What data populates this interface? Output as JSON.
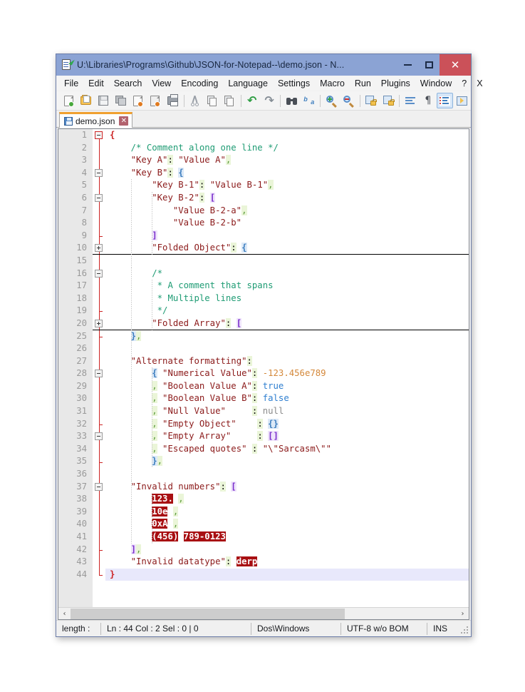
{
  "window": {
    "title": "U:\\Libraries\\Programs\\Github\\JSON-for-Notepad--\\demo.json - N...",
    "icon": "notepad-plus-plus-icon",
    "minimize_label": "",
    "maximize_label": "",
    "close_label": "✕"
  },
  "menubar": {
    "items": [
      {
        "label": "File"
      },
      {
        "label": "Edit"
      },
      {
        "label": "Search"
      },
      {
        "label": "View"
      },
      {
        "label": "Encoding"
      },
      {
        "label": "Language"
      },
      {
        "label": "Settings"
      },
      {
        "label": "Macro"
      },
      {
        "label": "Run"
      },
      {
        "label": "Plugins"
      },
      {
        "label": "Window"
      },
      {
        "label": "?"
      },
      {
        "label": "X"
      }
    ]
  },
  "toolbar": {
    "buttons": [
      {
        "name": "new-file-icon"
      },
      {
        "name": "open-file-icon"
      },
      {
        "name": "save-icon"
      },
      {
        "name": "save-all-icon"
      },
      {
        "name": "close-file-icon"
      },
      {
        "name": "close-all-files-icon"
      },
      {
        "name": "print-icon"
      },
      {
        "name": "cut-icon"
      },
      {
        "name": "copy-icon"
      },
      {
        "name": "paste-icon"
      },
      {
        "name": "undo-icon"
      },
      {
        "name": "redo-icon"
      },
      {
        "name": "find-icon"
      },
      {
        "name": "replace-icon"
      },
      {
        "name": "zoom-in-icon"
      },
      {
        "name": "zoom-out-icon"
      },
      {
        "name": "sync-vertical-scroll-icon"
      },
      {
        "name": "sync-horizontal-scroll-icon"
      },
      {
        "name": "word-wrap-icon"
      },
      {
        "name": "show-all-characters-icon"
      },
      {
        "name": "indent-guide-icon"
      },
      {
        "name": "show-ui-macro-icon"
      }
    ]
  },
  "tabs": [
    {
      "label": "demo.json",
      "close_label": "✕",
      "active": true
    }
  ],
  "editor": {
    "lines": [
      {
        "num": "1",
        "fold": "minus-red",
        "tokens": [
          {
            "t": "{",
            "c": "s-brace-red"
          }
        ]
      },
      {
        "num": "2",
        "fold": "line",
        "tokens": [
          {
            "t": "    ",
            "c": "s-plain"
          },
          {
            "t": "/* Comment along one line */",
            "c": "s-cmt"
          }
        ]
      },
      {
        "num": "3",
        "fold": "line",
        "tokens": [
          {
            "t": "    ",
            "c": "s-plain"
          },
          {
            "t": "\"Key A\"",
            "c": "s-str"
          },
          {
            "t": ":",
            "c": "s-colon"
          },
          {
            "t": " ",
            "c": "s-plain"
          },
          {
            "t": "\"Value A\"",
            "c": "s-str"
          },
          {
            "t": ",",
            "c": "s-comma"
          }
        ]
      },
      {
        "num": "4",
        "fold": "minus",
        "tokens": [
          {
            "t": "    ",
            "c": "s-plain"
          },
          {
            "t": "\"Key B\"",
            "c": "s-str"
          },
          {
            "t": ":",
            "c": "s-colon"
          },
          {
            "t": " ",
            "c": "s-plain"
          },
          {
            "t": "{",
            "c": "s-brace2"
          }
        ]
      },
      {
        "num": "5",
        "fold": "line",
        "tokens": [
          {
            "t": "        ",
            "c": "s-plain"
          },
          {
            "t": "\"Key B-1\"",
            "c": "s-str"
          },
          {
            "t": ":",
            "c": "s-colon"
          },
          {
            "t": " ",
            "c": "s-plain"
          },
          {
            "t": "\"Value B-1\"",
            "c": "s-str"
          },
          {
            "t": ",",
            "c": "s-comma"
          }
        ]
      },
      {
        "num": "6",
        "fold": "minus",
        "tokens": [
          {
            "t": "        ",
            "c": "s-plain"
          },
          {
            "t": "\"Key B-2\"",
            "c": "s-str"
          },
          {
            "t": ":",
            "c": "s-colon"
          },
          {
            "t": " ",
            "c": "s-plain"
          },
          {
            "t": "[",
            "c": "s-brace"
          }
        ]
      },
      {
        "num": "7",
        "fold": "line",
        "tokens": [
          {
            "t": "            ",
            "c": "s-plain"
          },
          {
            "t": "\"Value B-2-a\"",
            "c": "s-str"
          },
          {
            "t": ",",
            "c": "s-comma"
          }
        ]
      },
      {
        "num": "8",
        "fold": "line",
        "tokens": [
          {
            "t": "            ",
            "c": "s-plain"
          },
          {
            "t": "\"Value B-2-b\"",
            "c": "s-str"
          }
        ]
      },
      {
        "num": "9",
        "fold": "tick",
        "tokens": [
          {
            "t": "        ",
            "c": "s-plain"
          },
          {
            "t": "]",
            "c": "s-brace"
          }
        ]
      },
      {
        "num": "10",
        "fold": "plus",
        "rule": true,
        "tokens": [
          {
            "t": "        ",
            "c": "s-plain"
          },
          {
            "t": "\"Folded Object\"",
            "c": "s-str"
          },
          {
            "t": ":",
            "c": "s-colon"
          },
          {
            "t": " ",
            "c": "s-plain"
          },
          {
            "t": "{",
            "c": "s-brace2"
          }
        ]
      },
      {
        "num": "15",
        "fold": "line",
        "tokens": []
      },
      {
        "num": "16",
        "fold": "minus",
        "tokens": [
          {
            "t": "        ",
            "c": "s-plain"
          },
          {
            "t": "/*",
            "c": "s-cmt"
          }
        ]
      },
      {
        "num": "17",
        "fold": "line",
        "tokens": [
          {
            "t": "         ",
            "c": "s-plain"
          },
          {
            "t": "* A comment that spans",
            "c": "s-cmt"
          }
        ]
      },
      {
        "num": "18",
        "fold": "line",
        "tokens": [
          {
            "t": "         ",
            "c": "s-plain"
          },
          {
            "t": "* Multiple lines",
            "c": "s-cmt"
          }
        ]
      },
      {
        "num": "19",
        "fold": "tick",
        "tokens": [
          {
            "t": "         ",
            "c": "s-plain"
          },
          {
            "t": "*/",
            "c": "s-cmt"
          }
        ]
      },
      {
        "num": "20",
        "fold": "plus",
        "rule": true,
        "tokens": [
          {
            "t": "        ",
            "c": "s-plain"
          },
          {
            "t": "\"Folded Array\"",
            "c": "s-str"
          },
          {
            "t": ":",
            "c": "s-colon"
          },
          {
            "t": " ",
            "c": "s-plain"
          },
          {
            "t": "[",
            "c": "s-brace"
          }
        ]
      },
      {
        "num": "25",
        "fold": "tick",
        "tokens": [
          {
            "t": "    ",
            "c": "s-plain"
          },
          {
            "t": "}",
            "c": "s-brace2"
          },
          {
            "t": ",",
            "c": "s-comma"
          }
        ]
      },
      {
        "num": "26",
        "fold": "line",
        "tokens": []
      },
      {
        "num": "27",
        "fold": "line",
        "tokens": [
          {
            "t": "    ",
            "c": "s-plain"
          },
          {
            "t": "\"Alternate formatting\"",
            "c": "s-str"
          },
          {
            "t": ":",
            "c": "s-colon"
          }
        ]
      },
      {
        "num": "28",
        "fold": "minus",
        "tokens": [
          {
            "t": "        ",
            "c": "s-plain"
          },
          {
            "t": "{",
            "c": "s-brace2"
          },
          {
            "t": " ",
            "c": "s-plain"
          },
          {
            "t": "\"Numerical Value\"",
            "c": "s-str"
          },
          {
            "t": ":",
            "c": "s-colon"
          },
          {
            "t": " ",
            "c": "s-plain"
          },
          {
            "t": "-123.456e789",
            "c": "s-num"
          }
        ]
      },
      {
        "num": "29",
        "fold": "line",
        "tokens": [
          {
            "t": "        ",
            "c": "s-plain"
          },
          {
            "t": ",",
            "c": "s-comma"
          },
          {
            "t": " ",
            "c": "s-plain"
          },
          {
            "t": "\"Boolean Value A\"",
            "c": "s-str"
          },
          {
            "t": ":",
            "c": "s-colon"
          },
          {
            "t": " ",
            "c": "s-plain"
          },
          {
            "t": "true",
            "c": "s-bool"
          }
        ]
      },
      {
        "num": "30",
        "fold": "line",
        "tokens": [
          {
            "t": "        ",
            "c": "s-plain"
          },
          {
            "t": ",",
            "c": "s-comma"
          },
          {
            "t": " ",
            "c": "s-plain"
          },
          {
            "t": "\"Boolean Value B\"",
            "c": "s-str"
          },
          {
            "t": ":",
            "c": "s-colon"
          },
          {
            "t": " ",
            "c": "s-plain"
          },
          {
            "t": "false",
            "c": "s-bool"
          }
        ]
      },
      {
        "num": "31",
        "fold": "line",
        "tokens": [
          {
            "t": "        ",
            "c": "s-plain"
          },
          {
            "t": ",",
            "c": "s-comma"
          },
          {
            "t": " ",
            "c": "s-plain"
          },
          {
            "t": "\"Null Value\"",
            "c": "s-str"
          },
          {
            "t": "     ",
            "c": "s-plain"
          },
          {
            "t": ":",
            "c": "s-colon"
          },
          {
            "t": " ",
            "c": "s-plain"
          },
          {
            "t": "null",
            "c": "s-null"
          }
        ]
      },
      {
        "num": "32",
        "fold": "tick",
        "tokens": [
          {
            "t": "        ",
            "c": "s-plain"
          },
          {
            "t": ",",
            "c": "s-comma"
          },
          {
            "t": " ",
            "c": "s-plain"
          },
          {
            "t": "\"Empty Object\"",
            "c": "s-str"
          },
          {
            "t": "    ",
            "c": "s-plain"
          },
          {
            "t": ":",
            "c": "s-colon"
          },
          {
            "t": " ",
            "c": "s-plain"
          },
          {
            "t": "{}",
            "c": "s-empty-o"
          }
        ]
      },
      {
        "num": "33",
        "fold": "minus",
        "tokens": [
          {
            "t": "        ",
            "c": "s-plain"
          },
          {
            "t": ",",
            "c": "s-comma"
          },
          {
            "t": " ",
            "c": "s-plain"
          },
          {
            "t": "\"Empty Array\"",
            "c": "s-str"
          },
          {
            "t": "     ",
            "c": "s-plain"
          },
          {
            "t": ":",
            "c": "s-colon"
          },
          {
            "t": " ",
            "c": "s-plain"
          },
          {
            "t": "[]",
            "c": "s-empty-a"
          }
        ]
      },
      {
        "num": "34",
        "fold": "line",
        "tokens": [
          {
            "t": "        ",
            "c": "s-plain"
          },
          {
            "t": ",",
            "c": "s-comma"
          },
          {
            "t": " ",
            "c": "s-plain"
          },
          {
            "t": "\"Escaped quotes\"",
            "c": "s-str"
          },
          {
            "t": " ",
            "c": "s-plain"
          },
          {
            "t": ":",
            "c": "s-colon"
          },
          {
            "t": " ",
            "c": "s-plain"
          },
          {
            "t": "\"\\\"Sarcasm\\\"\"",
            "c": "s-str"
          }
        ]
      },
      {
        "num": "35",
        "fold": "tick",
        "tokens": [
          {
            "t": "        ",
            "c": "s-plain"
          },
          {
            "t": "}",
            "c": "s-brace2"
          },
          {
            "t": ",",
            "c": "s-comma"
          }
        ]
      },
      {
        "num": "36",
        "fold": "line",
        "tokens": []
      },
      {
        "num": "37",
        "fold": "minus",
        "tokens": [
          {
            "t": "    ",
            "c": "s-plain"
          },
          {
            "t": "\"Invalid numbers\"",
            "c": "s-str"
          },
          {
            "t": ":",
            "c": "s-colon"
          },
          {
            "t": " ",
            "c": "s-plain"
          },
          {
            "t": "[",
            "c": "s-brace"
          }
        ]
      },
      {
        "num": "38",
        "fold": "line",
        "tokens": [
          {
            "t": "        ",
            "c": "s-plain"
          },
          {
            "t": "123.",
            "c": "s-err"
          },
          {
            "t": " ",
            "c": "s-plain"
          },
          {
            "t": ",",
            "c": "s-comma"
          }
        ]
      },
      {
        "num": "39",
        "fold": "line",
        "tokens": [
          {
            "t": "        ",
            "c": "s-plain"
          },
          {
            "t": "10e",
            "c": "s-err"
          },
          {
            "t": " ",
            "c": "s-plain"
          },
          {
            "t": ",",
            "c": "s-comma"
          }
        ]
      },
      {
        "num": "40",
        "fold": "line",
        "tokens": [
          {
            "t": "        ",
            "c": "s-plain"
          },
          {
            "t": "0xA",
            "c": "s-err"
          },
          {
            "t": " ",
            "c": "s-plain"
          },
          {
            "t": ",",
            "c": "s-comma"
          }
        ]
      },
      {
        "num": "41",
        "fold": "line",
        "tokens": [
          {
            "t": "        ",
            "c": "s-plain"
          },
          {
            "t": "(456)",
            "c": "s-err"
          },
          {
            "t": " ",
            "c": "s-plain"
          },
          {
            "t": "789-0123",
            "c": "s-err"
          }
        ]
      },
      {
        "num": "42",
        "fold": "tick",
        "tokens": [
          {
            "t": "    ",
            "c": "s-plain"
          },
          {
            "t": "]",
            "c": "s-brace"
          },
          {
            "t": ",",
            "c": "s-comma"
          }
        ]
      },
      {
        "num": "43",
        "fold": "line",
        "tokens": [
          {
            "t": "    ",
            "c": "s-plain"
          },
          {
            "t": "\"Invalid datatype\"",
            "c": "s-str"
          },
          {
            "t": ":",
            "c": "s-colon"
          },
          {
            "t": " ",
            "c": "s-plain"
          },
          {
            "t": "derp",
            "c": "s-err"
          }
        ]
      },
      {
        "num": "44",
        "fold": "end",
        "current": true,
        "tokens": [
          {
            "t": "}",
            "c": "s-brace-red"
          }
        ]
      }
    ]
  },
  "scrollbar": {
    "left_arrow": "‹",
    "right_arrow": "›"
  },
  "statusbar": {
    "length_label": "length :",
    "position": "Ln : 44   Col : 2   Sel : 0 | 0",
    "eol": "Dos\\Windows",
    "encoding": "UTF-8 w/o BOM",
    "insert_mode": "INS"
  },
  "colors": {
    "titlebar": "#8ba3d4",
    "close_button": "#cb5159",
    "tab_accent": "#f0a030",
    "string": "#8b1a1a",
    "comment": "#1f9c74",
    "number": "#d4883a",
    "boolean": "#2f7fd0",
    "null": "#8a8a8a",
    "error_bg": "#a80f12",
    "fold_line": "#cc2222",
    "current_line": "#e8e8fb"
  }
}
